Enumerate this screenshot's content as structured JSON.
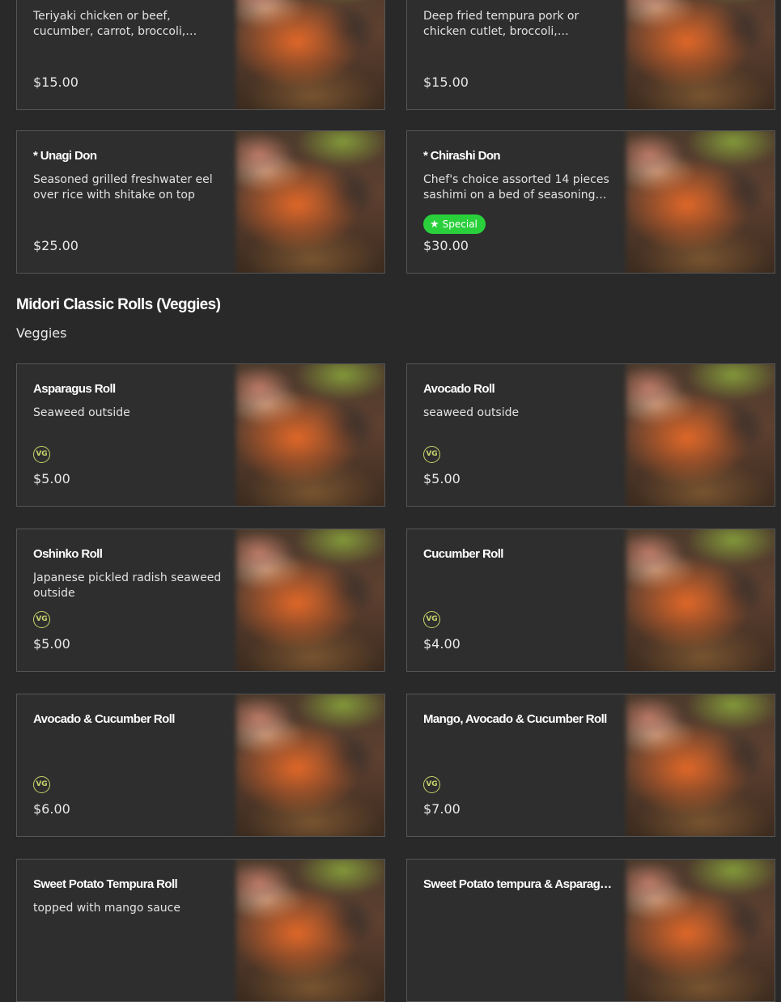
{
  "top_items": [
    {
      "name": "",
      "description": "Teriyaki chicken or beef, cucumber, carrot, broccoli, scallion, black an…",
      "price": "$15.00"
    },
    {
      "name": "",
      "description": "Deep fried tempura pork or chicken cutlet, broccoli, cucumbe…",
      "price": "$15.00"
    },
    {
      "name": "* Unagi Don",
      "description": "Seasoned grilled freshwater eel over rice with shitake on top",
      "price": "$25.00"
    },
    {
      "name": "* Chirashi Don",
      "description": "Chef's choice assorted 14 pieces sashimi on a bed of seasoning…",
      "price": "$30.00",
      "badge": "Special"
    }
  ],
  "section": {
    "title": "Midori Classic Rolls (Veggies)",
    "description": "Veggies",
    "items": [
      {
        "name": "Asparagus Roll",
        "description": "Seaweed outside",
        "price": "$5.00",
        "tag": "VG"
      },
      {
        "name": "Avocado Roll",
        "description": "seaweed outside",
        "price": "$5.00",
        "tag": "VG"
      },
      {
        "name": "Oshinko Roll",
        "description": "Japanese pickled radish seaweed outside",
        "price": "$5.00",
        "tag": "VG"
      },
      {
        "name": "Cucumber Roll",
        "description": "",
        "price": "$4.00",
        "tag": "VG"
      },
      {
        "name": "Avocado & Cucumber Roll",
        "description": "",
        "price": "$6.00",
        "tag": "VG"
      },
      {
        "name": "Mango, Avocado & Cucumber Roll",
        "description": "",
        "price": "$7.00",
        "tag": "VG"
      },
      {
        "name": "Sweet Potato Tempura Roll",
        "description": "topped with mango sauce",
        "price": ""
      },
      {
        "name": "Sweet Potato tempura & Asparagus…",
        "description": "",
        "price": ""
      }
    ]
  },
  "colors": {
    "background": "#292929",
    "card": "#2e2e2e",
    "border": "#555555",
    "special": "#2ad03b",
    "vg": "#c8d26a"
  },
  "icons": {
    "special": "star-icon",
    "vegetarian": "vg-badge-icon"
  }
}
